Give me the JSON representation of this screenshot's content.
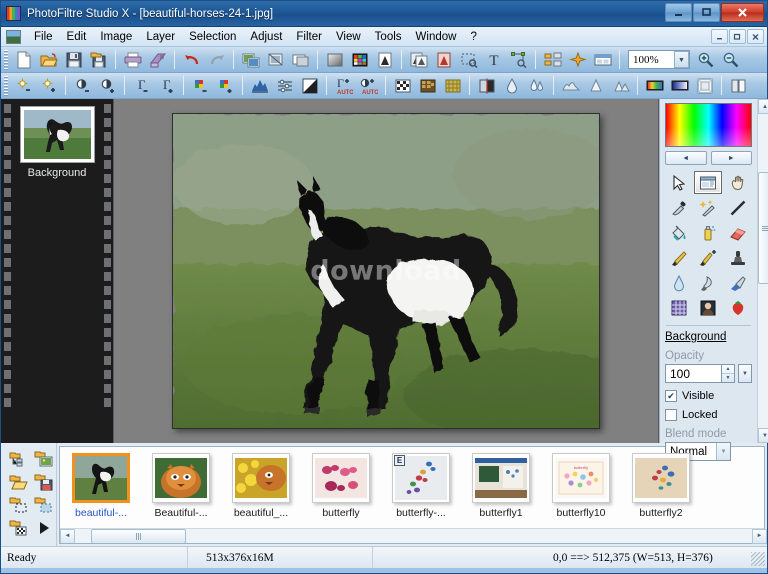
{
  "window": {
    "title": "PhotoFiltre Studio X - [beautiful-horses-24-1.jpg]",
    "minimize_label": "–",
    "maximize_label": "❐",
    "close_label": "✕"
  },
  "menu": {
    "items": [
      {
        "label": "File"
      },
      {
        "label": "Edit"
      },
      {
        "label": "Image"
      },
      {
        "label": "Layer"
      },
      {
        "label": "Selection"
      },
      {
        "label": "Adjust"
      },
      {
        "label": "Filter"
      },
      {
        "label": "View"
      },
      {
        "label": "Tools"
      },
      {
        "label": "Window"
      },
      {
        "label": "?"
      }
    ],
    "doc_minimize": "–",
    "doc_restore": "❐",
    "doc_close": "✕"
  },
  "toolbar_main": {
    "buttons": [
      {
        "name": "new-file-icon",
        "title": "New"
      },
      {
        "name": "open-file-icon",
        "title": "Open"
      },
      {
        "name": "save-icon",
        "title": "Save"
      },
      {
        "name": "save-as-icon",
        "title": "Save As"
      },
      {
        "name": "print-icon",
        "title": "Print"
      },
      {
        "name": "print-preview-icon",
        "title": "Print Preview"
      },
      {
        "name": "undo-icon",
        "title": "Undo"
      },
      {
        "name": "redo-icon",
        "title": "Redo"
      },
      {
        "name": "duplicate-image-icon",
        "title": "Duplicate"
      },
      {
        "name": "image-size-icon",
        "title": "Image Size"
      },
      {
        "name": "canvas-size-icon",
        "title": "Canvas Size"
      },
      {
        "name": "grayscale-icon",
        "title": "Grayscale"
      },
      {
        "name": "color-palette-icon",
        "title": "Color Palette"
      },
      {
        "name": "transparency-icon",
        "title": "Transparency"
      },
      {
        "name": "mask-icon",
        "title": "Mask"
      },
      {
        "name": "red-mask-icon",
        "title": "Red Mask"
      },
      {
        "name": "selection-icon",
        "title": "Selection"
      },
      {
        "name": "text-tool-icon",
        "title": "Text"
      },
      {
        "name": "transform-icon",
        "title": "Transform"
      },
      {
        "name": "layers-icon",
        "title": "Layers"
      },
      {
        "name": "effects-icon",
        "title": "Effects"
      },
      {
        "name": "browser-icon",
        "title": "Browser"
      }
    ],
    "zoom_value": "100%",
    "zoom_dropdown_icon": "chevron-down-icon",
    "zoom_in_icon": "zoom-in-icon",
    "zoom_out_icon": "zoom-out-icon"
  },
  "toolbar_adjust": {
    "buttons": [
      {
        "name": "brightness-decrease-icon",
        "title": "Brightness -"
      },
      {
        "name": "brightness-increase-icon",
        "title": "Brightness +"
      },
      {
        "name": "contrast-decrease-icon",
        "title": "Contrast -"
      },
      {
        "name": "contrast-increase-icon",
        "title": "Contrast +"
      },
      {
        "name": "gamma-decrease-icon",
        "title": "Gamma -"
      },
      {
        "name": "gamma-increase-icon",
        "title": "Gamma +"
      },
      {
        "name": "saturation-decrease-icon",
        "title": "Saturation -"
      },
      {
        "name": "saturation-increase-icon",
        "title": "Saturation +"
      },
      {
        "name": "histogram-icon",
        "title": "Histogram"
      },
      {
        "name": "levels-icon",
        "title": "Levels"
      },
      {
        "name": "auto-contrast-icon",
        "title": "Auto Contrast"
      },
      {
        "name": "auto-gamma-icon",
        "title": "Auto Gamma",
        "badge": "AUTO"
      },
      {
        "name": "auto-levels-icon",
        "title": "Auto Levels",
        "badge": "AUTO"
      },
      {
        "name": "dither-icon",
        "title": "Dither"
      },
      {
        "name": "mosaic-icon",
        "title": "Mosaic"
      },
      {
        "name": "texture-icon",
        "title": "Texture"
      },
      {
        "name": "half-tone-icon",
        "title": "Halftone"
      },
      {
        "name": "split-tone-icon",
        "title": "Split Tone"
      },
      {
        "name": "blur-icon",
        "title": "Blur"
      },
      {
        "name": "sharpen-icon",
        "title": "Sharpen"
      },
      {
        "name": "soften-icon",
        "title": "Soften"
      },
      {
        "name": "noise-icon",
        "title": "Noise"
      },
      {
        "name": "grain-icon",
        "title": "Grain"
      },
      {
        "name": "gradient-color-icon",
        "title": "Color Gradient"
      },
      {
        "name": "gradient-blue-icon",
        "title": "Blue Gradient"
      },
      {
        "name": "frame-icon",
        "title": "Frame"
      },
      {
        "name": "book-icon",
        "title": "Pages"
      }
    ]
  },
  "layers_panel": {
    "layer_name": "Background"
  },
  "canvas": {
    "watermark": "download"
  },
  "right_panel": {
    "color_gradient_name": "color-gradient-swatch",
    "nav_prev": "◄",
    "nav_next": "►",
    "tools": [
      {
        "name": "pointer-tool-icon",
        "title": "Select",
        "active": false
      },
      {
        "name": "rectangle-select-tool-icon",
        "title": "Rectangle Select",
        "active": true
      },
      {
        "name": "hand-tool-icon",
        "title": "Hand",
        "active": false
      },
      {
        "name": "eyedropper-tool-icon",
        "title": "Color Picker",
        "active": false
      },
      {
        "name": "magic-wand-tool-icon",
        "title": "Magic Wand",
        "active": false
      },
      {
        "name": "line-tool-icon",
        "title": "Line",
        "active": false
      },
      {
        "name": "paint-bucket-tool-icon",
        "title": "Fill",
        "active": false
      },
      {
        "name": "spray-can-tool-icon",
        "title": "Airbrush",
        "active": false
      },
      {
        "name": "eraser-tool-icon",
        "title": "Eraser",
        "active": false
      },
      {
        "name": "paintbrush-tool-icon",
        "title": "Paintbrush",
        "active": false
      },
      {
        "name": "advanced-brush-tool-icon",
        "title": "Advanced Brush",
        "active": false
      },
      {
        "name": "stamp-tool-icon",
        "title": "Clone Stamp",
        "active": false
      },
      {
        "name": "waterdrop-tool-icon",
        "title": "Blur Tool",
        "active": false
      },
      {
        "name": "smudge-tool-icon",
        "title": "Smudge",
        "active": false
      },
      {
        "name": "brush-sweep-tool-icon",
        "title": "Sweep Brush",
        "active": false
      },
      {
        "name": "grid-pattern-tool-icon",
        "title": "Pattern",
        "active": false
      },
      {
        "name": "portrait-tool-icon",
        "title": "Portrait",
        "active": false
      },
      {
        "name": "strawberry-stamp-tool-icon",
        "title": "Clipart",
        "active": false
      }
    ],
    "layer_title": "Background",
    "opacity_label": "Opacity",
    "opacity_value": "100",
    "visible_label": "Visible",
    "visible_checked": true,
    "locked_label": "Locked",
    "locked_checked": false,
    "blend_mode_label": "Blend mode",
    "blend_mode_value": "Normal",
    "check_glyph": "✔"
  },
  "browser": {
    "tools": [
      {
        "name": "folder-tree-icon",
        "title": "Folder Tree"
      },
      {
        "name": "folder-image-icon",
        "title": "Image Folder"
      },
      {
        "name": "folder-open-icon",
        "title": "Open Folder"
      },
      {
        "name": "folder-save-icon",
        "title": "Save Folder"
      },
      {
        "name": "folder-select-icon",
        "title": "Select"
      },
      {
        "name": "folder-refresh-icon",
        "title": "Refresh"
      },
      {
        "name": "folder-thumbnails-icon",
        "title": "Thumbnails"
      },
      {
        "name": "slideshow-play-icon",
        "title": "Slideshow"
      }
    ],
    "thumbnails": [
      {
        "label": "beautiful-...",
        "selected": true,
        "badge": null,
        "kind": "horse"
      },
      {
        "label": "Beautiful-...",
        "selected": false,
        "badge": null,
        "kind": "tiger"
      },
      {
        "label": "beautiful_...",
        "selected": false,
        "badge": null,
        "kind": "tiger-flowers"
      },
      {
        "label": "butterfly",
        "selected": false,
        "badge": null,
        "kind": "butterfly-pink"
      },
      {
        "label": "butterfly-...",
        "selected": false,
        "badge": "E",
        "kind": "butterfly-wall"
      },
      {
        "label": "butterfly1",
        "selected": false,
        "badge": null,
        "kind": "butterfly-room"
      },
      {
        "label": "butterfly10",
        "selected": false,
        "badge": null,
        "kind": "butterfly-card"
      },
      {
        "label": "butterfly2",
        "selected": false,
        "badge": null,
        "kind": "butterfly-tan"
      }
    ],
    "scroll_left": "◄",
    "scroll_right": "►"
  },
  "statusbar": {
    "status": "Ready",
    "dimensions": "513x376x16M",
    "coordinates": "0,0 ==> 512,375 (W=513, H=376)"
  }
}
